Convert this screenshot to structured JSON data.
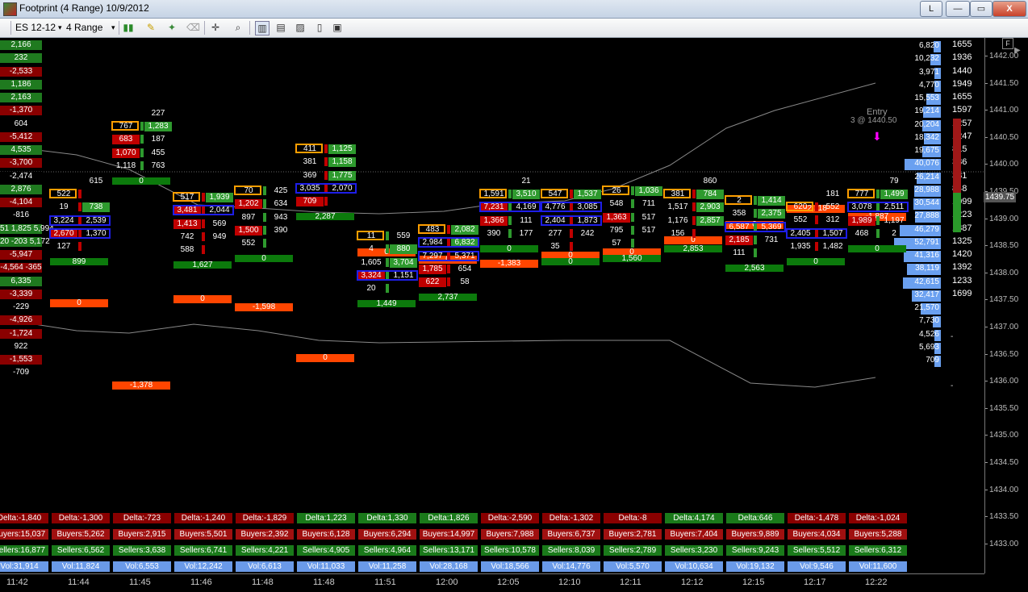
{
  "window": {
    "title": "Footprint (4 Range)  10/9/2012",
    "btn_l": "L",
    "btn_min": "—",
    "btn_max": "▭",
    "btn_close": "X"
  },
  "toolbar": {
    "instrument": "ES 12-12",
    "period": "4 Range",
    "icons": [
      "candlestick-icon",
      "pencil-icon",
      "wand-icon",
      "eraser-icon",
      "crosshair-icon",
      "zoom-icon",
      "bar-icon",
      "chart-icon",
      "picture-icon",
      "page-icon",
      "panel-icon"
    ]
  },
  "colors": {
    "bid": "#c00000",
    "ask": "#2e9a2e",
    "blue": "#1e1ee8",
    "orange": "#ff9e00",
    "header": "#ff4500",
    "total": "#0c7a0c",
    "volbar": "#6aa0f0"
  },
  "chart_labels": {
    "entry_text": "Entry",
    "entry_price": "3 @ 1440.50",
    "f_button": "F",
    "current_price": "1439.75"
  },
  "price_axis": {
    "ticks": [
      "1442.00",
      "1441.50",
      "1441.00",
      "1440.50",
      "1440.00",
      "1439.50",
      "1439.00",
      "1438.50",
      "1438.00",
      "1437.50",
      "1437.00",
      "1436.50",
      "1436.00",
      "1435.50",
      "1435.00",
      "1434.50",
      "1434.00",
      "1433.50",
      "1433.00"
    ],
    "volume": [
      "1655",
      "1936",
      "1440",
      "1949",
      "1655",
      "1597",
      "1257",
      "1247",
      "815",
      "336",
      "381",
      "848",
      "1099",
      "1223",
      "1387",
      "1325",
      "1420",
      "1392",
      "1233",
      "1699"
    ]
  },
  "time_axis": [
    "11:42",
    "11:44",
    "11:45",
    "11:46",
    "11:48",
    "11:48",
    "11:51",
    "12:00",
    "12:05",
    "12:10",
    "12:11",
    "12:12",
    "12:15",
    "12:17",
    "12:22"
  ],
  "left_profile": [
    "2,166",
    "232",
    "-2,533",
    "1,186",
    "2,163",
    "-1,370",
    "604",
    "-5,412",
    "4,535",
    "-3,700",
    "-2,474",
    "2,876",
    "-4,104",
    "-816",
    "51  1,825  5,994",
    "20  -203  5,172",
    "-5,947",
    "-4,564  -365",
    "6,335",
    "-3,339",
    "-229",
    "-4,926",
    "-1,724",
    "922",
    "-1,553",
    "-709"
  ],
  "vol_profile": [
    "6,820",
    "10,232",
    "3,971",
    "4,770",
    "15,553",
    "19,214",
    "20,204",
    "18,342",
    "19,675",
    "40,076",
    "26,214",
    "28,988",
    "30,544",
    "27,888",
    "46,279",
    "52,791",
    "41,316",
    "38,119",
    "42,615",
    "32,417",
    "21,570",
    "7,730",
    "4,526",
    "5,693",
    "709"
  ],
  "headers": [
    "0",
    "-1,378",
    "0",
    "-1,598",
    "0",
    "0",
    "0",
    "-1,383",
    "0",
    "0",
    "0",
    "0",
    "-2,118",
    "-1,887"
  ],
  "bar_totals": [
    "899",
    "0",
    "1,627",
    "0",
    "2,287",
    "1,449",
    "2,737",
    "0",
    "0",
    "1,560",
    "2,853",
    "2,563",
    "0",
    "0"
  ],
  "stats": {
    "delta": [
      "Delta:-1,840",
      "Delta:-1,300",
      "Delta:-723",
      "Delta:-1,240",
      "Delta:-1,829",
      "Delta:1,223",
      "Delta:1,330",
      "Delta:1,826",
      "Delta:-2,590",
      "Delta:-1,302",
      "Delta:-8",
      "Delta:4,174",
      "Delta:646",
      "Delta:-1,478",
      "Delta:-1,024"
    ],
    "buyers": [
      "Buyers:15,037",
      "Buyers:5,262",
      "Buyers:2,915",
      "Buyers:5,501",
      "Buyers:2,392",
      "Buyers:6,128",
      "Buyers:6,294",
      "Buyers:14,997",
      "Buyers:7,988",
      "Buyers:6,737",
      "Buyers:2,781",
      "Buyers:7,404",
      "Buyers:9,889",
      "Buyers:4,034",
      "Buyers:5,288"
    ],
    "sellers": [
      "Sellers:16,877",
      "Sellers:6,562",
      "Sellers:3,638",
      "Sellers:6,741",
      "Sellers:4,221",
      "Sellers:4,905",
      "Sellers:4,964",
      "Sellers:13,171",
      "Sellers:10,578",
      "Sellers:8,039",
      "Sellers:2,789",
      "Sellers:3,230",
      "Sellers:9,243",
      "Sellers:5,512",
      "Sellers:6,312"
    ],
    "vol": [
      "Vol:31,914",
      "Vol:11,824",
      "Vol:6,553",
      "Vol:12,242",
      "Vol:6,613",
      "Vol:11,033",
      "Vol:11,258",
      "Vol:28,168",
      "Vol:18,566",
      "Vol:14,776",
      "Vol:5,570",
      "Vol:10,634",
      "Vol:19,132",
      "Vol:9,546",
      "Vol:11,600"
    ]
  },
  "bars": [
    {
      "rows": [
        [
          "522",
          ""
        ],
        [
          "19",
          "738"
        ],
        [
          "3,224",
          "2,539"
        ],
        [
          "2,670",
          "1,370"
        ],
        [
          "127",
          ""
        ]
      ],
      "extra": [
        "615"
      ]
    },
    {
      "rows": [
        [
          "767",
          "1,283"
        ],
        [
          "683",
          "187"
        ],
        [
          "1,070",
          "455"
        ],
        [
          "1,118",
          "763"
        ]
      ],
      "extra": [
        "227"
      ]
    },
    {
      "rows": [
        [
          "517",
          "1,939"
        ],
        [
          "3,481",
          "2,044"
        ],
        [
          "1,413",
          "569"
        ],
        [
          "742",
          "949"
        ],
        [
          "588",
          ""
        ]
      ],
      "extra": []
    },
    {
      "rows": [
        [
          "70",
          "425"
        ],
        [
          "1,202",
          "634"
        ],
        [
          "897",
          "943"
        ],
        [
          "1,500",
          "390"
        ],
        [
          "552",
          ""
        ]
      ],
      "extra": []
    },
    {
      "rows": [
        [
          "411",
          "1,125"
        ],
        [
          "381",
          "1,158"
        ],
        [
          "369",
          "1,775"
        ],
        [
          "3,035",
          "2,070"
        ],
        [
          "709",
          ""
        ]
      ],
      "extra": []
    },
    {
      "rows": [
        [
          "11",
          "559"
        ],
        [
          "4",
          "880"
        ],
        [
          "1,605",
          "3,704"
        ],
        [
          "3,324",
          "1,151"
        ],
        [
          "20",
          ""
        ]
      ],
      "extra": []
    },
    {
      "rows": [
        [
          "483",
          "2,082"
        ],
        [
          "2,984",
          "6,832"
        ],
        [
          "7,297",
          "5,371"
        ],
        [
          "1,785",
          "654"
        ],
        [
          "622",
          "58"
        ]
      ],
      "extra": []
    },
    {
      "rows": [
        [
          "1,591",
          "3,510"
        ],
        [
          "7,231",
          "4,169"
        ],
        [
          "1,366",
          "111"
        ],
        [
          "390",
          "177"
        ]
      ],
      "extra": [
        "21"
      ]
    },
    {
      "rows": [
        [
          "547",
          "1,537"
        ],
        [
          "4,776",
          "3,085"
        ],
        [
          "2,404",
          "1,873"
        ],
        [
          "277",
          "242"
        ],
        [
          "35",
          ""
        ]
      ],
      "extra": []
    },
    {
      "rows": [
        [
          "26",
          "1,036"
        ],
        [
          "548",
          "711"
        ],
        [
          "1,363",
          "517"
        ],
        [
          "795",
          "517"
        ],
        [
          "57",
          ""
        ]
      ],
      "extra": []
    },
    {
      "rows": [
        [
          "381",
          "784"
        ],
        [
          "1,517",
          "2,903"
        ],
        [
          "1,176",
          "2,857"
        ],
        [
          "156",
          ""
        ]
      ],
      "extra": [
        "860"
      ]
    },
    {
      "rows": [
        [
          "2",
          "1,414"
        ],
        [
          "358",
          "2,375"
        ],
        [
          "6,587",
          "5,369"
        ],
        [
          "2,185",
          "731"
        ],
        [
          "111",
          ""
        ]
      ],
      "extra": []
    },
    {
      "rows": [
        [
          "620",
          "552"
        ],
        [
          "552",
          "312"
        ],
        [
          "2,405",
          "1,507"
        ],
        [
          "1,935",
          "1,482"
        ]
      ],
      "extra": [
        "181"
      ]
    },
    {
      "rows": [
        [
          "777",
          "1,499"
        ],
        [
          "3,078",
          "2,511"
        ],
        [
          "1,989",
          "1,197"
        ],
        [
          "468",
          "2"
        ]
      ],
      "extra": [
        "79"
      ]
    }
  ]
}
